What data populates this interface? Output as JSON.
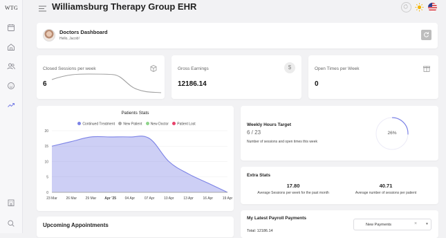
{
  "sidebar": {
    "logo": "WTG",
    "items": [
      {
        "icon": "calendar-icon"
      },
      {
        "icon": "home-icon"
      },
      {
        "icon": "users-icon"
      },
      {
        "icon": "smiley-icon"
      },
      {
        "icon": "trending-icon"
      }
    ],
    "bottom": [
      {
        "icon": "building-icon"
      },
      {
        "icon": "search-icon"
      }
    ]
  },
  "header": {
    "title": "Williamsburg Therapy Group EHR",
    "icons": [
      "sync-icon",
      "sun-icon",
      "us-flag-icon"
    ]
  },
  "dashboard": {
    "title": "Doctors Dashboard",
    "greeting": "Hello, Jacob!"
  },
  "stats": {
    "closed_sessions": {
      "label": "Closed Sessions per week",
      "value": "6"
    },
    "gross_earnings": {
      "label": "Gross Earnings",
      "value": "12186.14"
    },
    "open_times": {
      "label": "Open Times per Week",
      "value": "0"
    }
  },
  "patients_chart": {
    "title": "Patients Stats"
  },
  "chart_data": {
    "type": "area",
    "title": "Patients Stats",
    "categories": [
      "23 Mar",
      "26 Mar",
      "29 Mar",
      "Apr '25",
      "04 Apr",
      "07 Apr",
      "10 Apr",
      "13 Apr",
      "16 Apr",
      "19 Apr"
    ],
    "series": [
      {
        "name": "Continued Treatment",
        "color": "#7b82e6",
        "values": [
          15,
          16.5,
          18,
          18,
          18,
          17.5,
          10,
          6,
          3,
          0
        ]
      },
      {
        "name": "New Patient",
        "color": "#a9a9a9",
        "values": [
          0,
          0,
          0,
          0,
          0,
          0,
          0,
          0,
          0,
          0
        ]
      },
      {
        "name": "New Doctor",
        "color": "#8fd48a",
        "values": [
          0,
          0,
          0,
          0,
          0,
          0,
          0,
          0,
          0,
          0
        ]
      },
      {
        "name": "Patient Lost",
        "color": "#e8436b",
        "values": [
          0,
          0,
          0,
          0,
          0,
          0,
          0,
          0,
          0,
          0
        ]
      }
    ],
    "yticks": [
      0,
      5,
      10,
      15,
      20
    ],
    "ylim": [
      0,
      20
    ],
    "grid": true,
    "legend": "top-center"
  },
  "weekly_hours": {
    "title": "Weekly Hours Target",
    "value": "6 / 23",
    "description": "Number of sessions and open times this week",
    "percent_label": "26%",
    "percent": 26
  },
  "extra_stats": {
    "title": "Extra Stats",
    "avg_sessions_value": "17.80",
    "avg_sessions_label": "Average Sessions per week for the past month",
    "avg_per_patient_value": "40.71",
    "avg_per_patient_label": "Average number of sessions per patient"
  },
  "payroll": {
    "title": "My Latest Payroll Payments",
    "total": "Total: 12186.14",
    "filter_value": "New Payments"
  },
  "appointments": {
    "title": "Upcoming Appointments"
  },
  "colors": {
    "accent": "#7b82e6",
    "ring_track": "#ecebf7"
  }
}
